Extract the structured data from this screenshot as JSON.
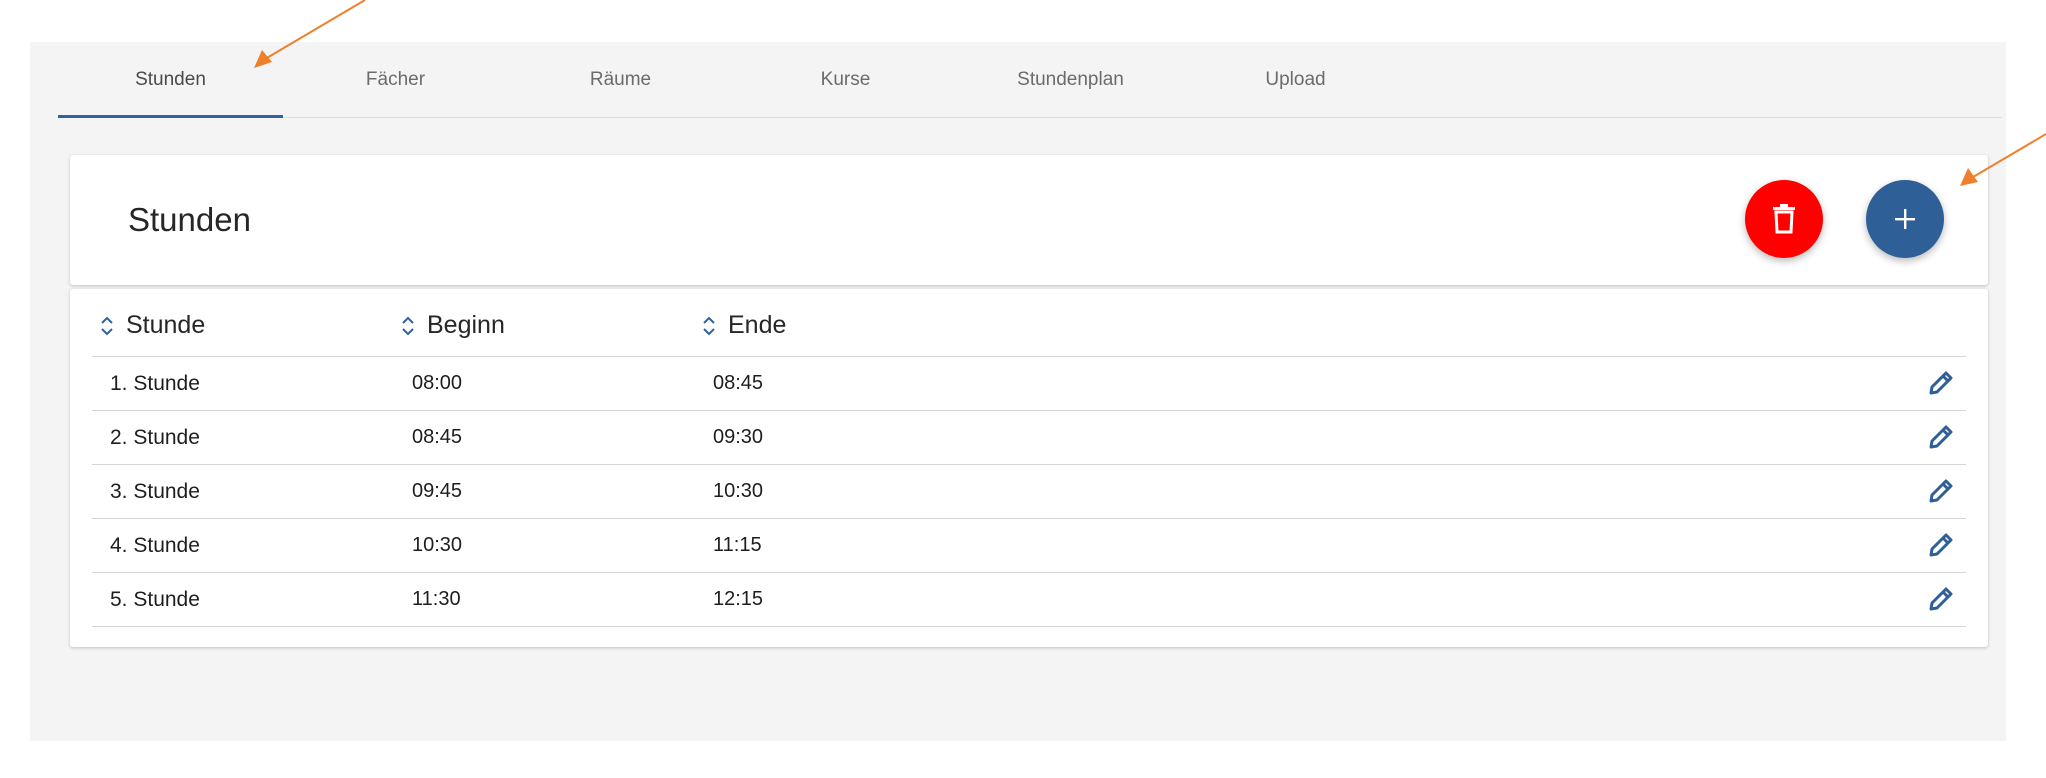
{
  "tabs": [
    {
      "label": "Stunden",
      "active": true
    },
    {
      "label": "Fächer",
      "active": false
    },
    {
      "label": "Räume",
      "active": false
    },
    {
      "label": "Kurse",
      "active": false
    },
    {
      "label": "Stundenplan",
      "active": false
    },
    {
      "label": "Upload",
      "active": false
    }
  ],
  "header": {
    "title": "Stunden",
    "delete_icon": "trash-icon",
    "add_icon": "plus-icon"
  },
  "table": {
    "columns": [
      "Stunde",
      "Beginn",
      "Ende"
    ],
    "rows": [
      {
        "stunde": "1. Stunde",
        "beginn": "08:00",
        "ende": "08:45"
      },
      {
        "stunde": "2. Stunde",
        "beginn": "08:45",
        "ende": "09:30"
      },
      {
        "stunde": "3. Stunde",
        "beginn": "09:45",
        "ende": "10:30"
      },
      {
        "stunde": "4. Stunde",
        "beginn": "10:30",
        "ende": "11:15"
      },
      {
        "stunde": "5. Stunde",
        "beginn": "11:30",
        "ende": "12:15"
      }
    ],
    "row_icon": "pencil-icon",
    "sort_icon": "sort-chevrons-icon"
  },
  "colors": {
    "accent": "#2f63a0",
    "danger": "#ff0000",
    "primary": "#2f5f97",
    "annotation_arrow": "#f07f2d"
  }
}
